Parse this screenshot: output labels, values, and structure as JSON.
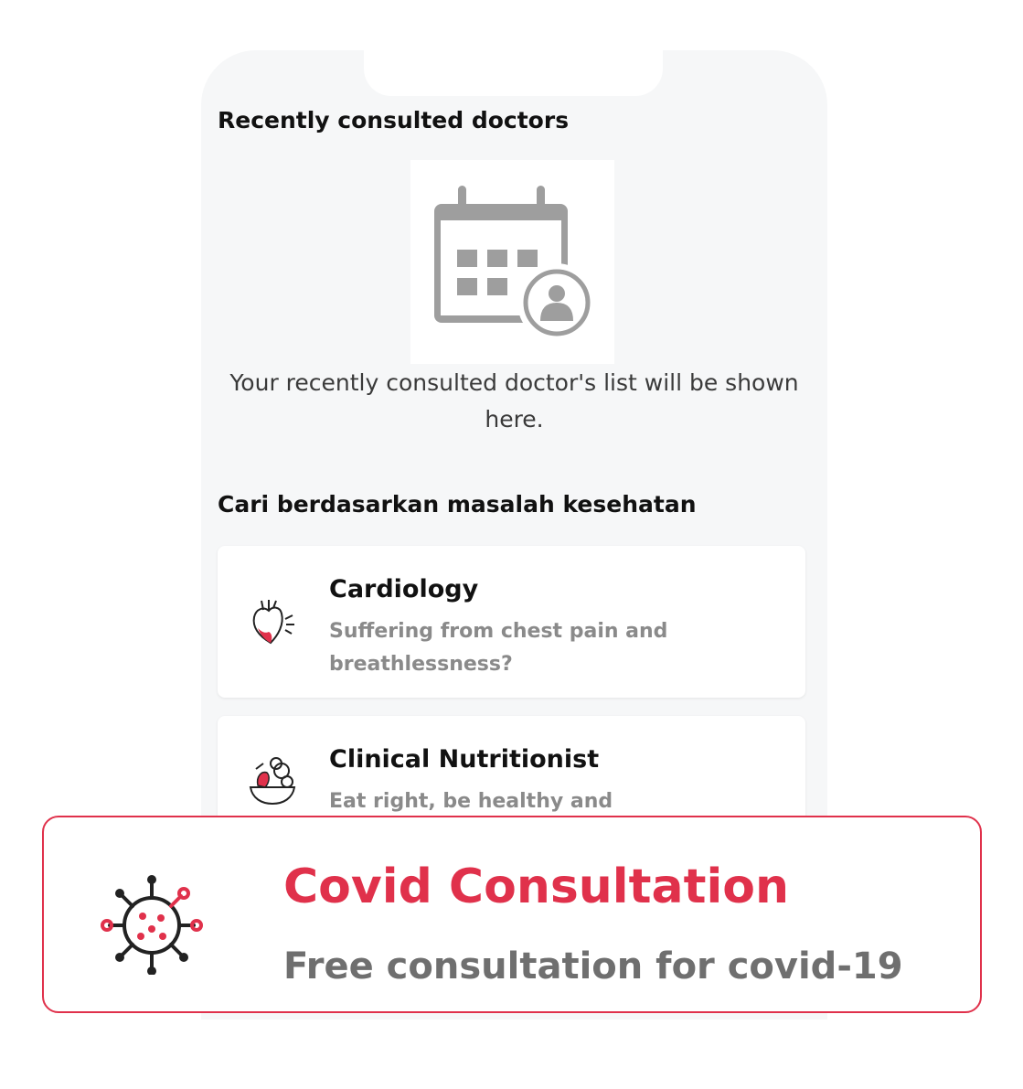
{
  "recent": {
    "title": "Recently consulted doctors",
    "empty_message": "Your recently consulted doctor's list will be shown here."
  },
  "search": {
    "title": "Cari berdasarkan masalah kesehatan",
    "categories": [
      {
        "title": "Cardiology",
        "description": "Suffering from chest pain and breathlessness?",
        "icon": "heart-icon"
      },
      {
        "title": "Clinical Nutritionist",
        "description": "Eat right, be healthy and weight",
        "icon": "nutrition-bowl-icon"
      }
    ]
  },
  "covid": {
    "title": "Covid Consultation",
    "subtitle": "Free consultation for covid-19",
    "icon": "virus-icon",
    "accent": "#e0314b"
  }
}
